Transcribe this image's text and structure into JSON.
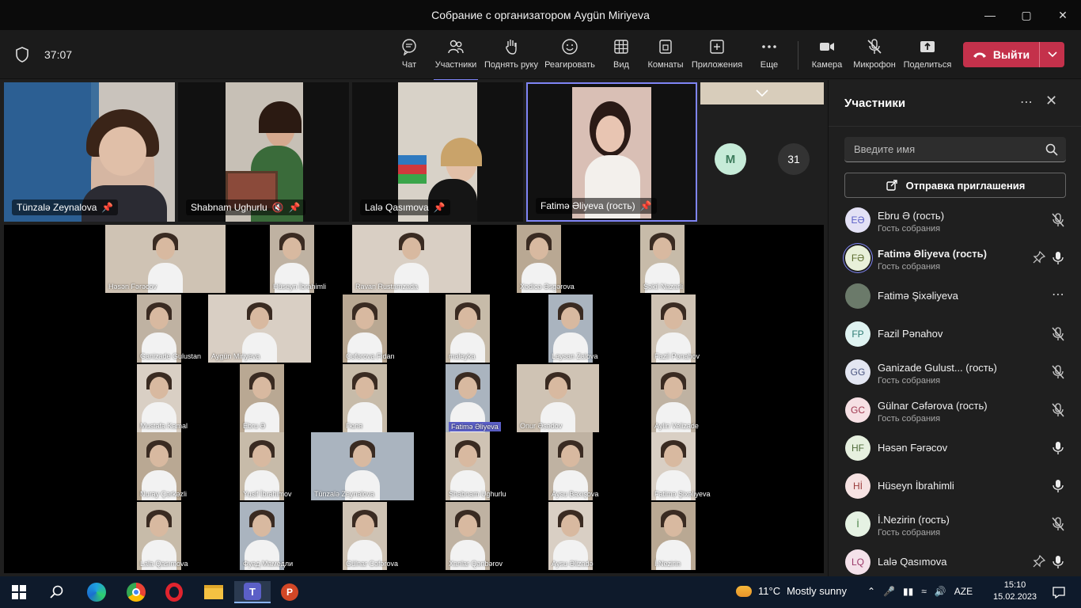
{
  "window": {
    "title": "Собрание с организатором Aygün Miriyeva"
  },
  "toolbar": {
    "timer": "37:07",
    "buttons": [
      {
        "label": "Чат"
      },
      {
        "label": "Участники"
      },
      {
        "label": "Поднять руку"
      },
      {
        "label": "Реагировать"
      },
      {
        "label": "Вид"
      },
      {
        "label": "Комнаты"
      },
      {
        "label": "Приложения"
      },
      {
        "label": "Еще"
      },
      {
        "label": "Камера"
      },
      {
        "label": "Микрофон"
      },
      {
        "label": "Поделиться"
      }
    ],
    "leave_label": "Выйти"
  },
  "stage": {
    "pinned": [
      {
        "name": "Tünzalə Zeynalova"
      },
      {
        "name": "Shabnam Ughurlu"
      },
      {
        "name": "Lalə Qasımova"
      },
      {
        "name": "Fatimə Əliyeva (гость)"
      }
    ],
    "overflow": {
      "avatar_initial": "M",
      "count": "31"
    },
    "grid_labels": [
      "Həsən Fərəcov",
      "Hüseyn İbrahimli",
      "Ravan Rustamzada",
      "Xədicə Əsgərova",
      "Şəkil Nazarli",
      "Ganizade Gulustan",
      "Aygün Miriyeva",
      "Cəfərova Fidan",
      "maleyka",
      "Leysan Zalova",
      "Fazil Pənahov",
      "Mustafa Kamal",
      "Ebru Ə",
      "Гюля",
      "Fatimə Əliyeva",
      "Onur Əsədov",
      "Aylin Velizade",
      "Nuray Çərkəzli",
      "Yusif İbrahimov",
      "Tünzalə Zeynalova",
      "Shabnam Ughurlu",
      "Aysu Baxışova",
      "Fatimə Şixəliyeva",
      "Lala Qasımova",
      "Фуад Мамедли",
      "Gülnar Cəfərova",
      "Xanlar Qənbərov",
      "Aysu Əlizadə",
      "İ.Nezirin"
    ]
  },
  "panel": {
    "title": "Участники",
    "search_placeholder": "Введите имя",
    "invite_label": "Отправка приглашения",
    "participants": [
      {
        "initials": "EƏ",
        "name": "Ebru Ə (гость)",
        "role": "Гость собрания",
        "bg": "#e3e1f5",
        "fg": "#5b5fc7",
        "mic": "off"
      },
      {
        "initials": "FƏ",
        "name": "Fatimə Əliyeva (гость)",
        "role": "Гость собрания",
        "bg": "#e8f0d9",
        "fg": "#5a6b2d",
        "mic": "on",
        "pinned": true,
        "bold": true
      },
      {
        "initials": "",
        "name": "Fatimə Şixəliyeva",
        "role": "",
        "bg": "#6b7a6a",
        "fg": "#fff",
        "mic": "more"
      },
      {
        "initials": "FP",
        "name": "Fazil Pənahov",
        "role": "",
        "bg": "#dff3f1",
        "fg": "#2f7c74",
        "mic": "off"
      },
      {
        "initials": "GG",
        "name": "Ganizade Gulust...  (гость)",
        "role": "Гость собрания",
        "bg": "#e3e6f2",
        "fg": "#4a5580",
        "mic": "off"
      },
      {
        "initials": "GC",
        "name": "Gülnar Cəfərova (гость)",
        "role": "Гость собрания",
        "bg": "#f6e0e4",
        "fg": "#a03a52",
        "mic": "off"
      },
      {
        "initials": "HF",
        "name": "Həsən Fərəcov",
        "role": "",
        "bg": "#e6f0df",
        "fg": "#4f6b3a",
        "mic": "on"
      },
      {
        "initials": "Hİ",
        "name": "Hüseyn İbrahimli",
        "role": "",
        "bg": "#f6e2e2",
        "fg": "#9a3a3a",
        "mic": "on"
      },
      {
        "initials": "İ",
        "name": "İ.Nezirin (гость)",
        "role": "Гость собрания",
        "bg": "#e5f2e3",
        "fg": "#3d7a3a",
        "mic": "off"
      },
      {
        "initials": "LQ",
        "name": "Lalə Qasımova",
        "role": "",
        "bg": "#f4e1ea",
        "fg": "#9c3a6a",
        "mic": "on",
        "pinned": true
      }
    ]
  },
  "taskbar": {
    "weather_temp": "11°C",
    "weather_text": "Mostly sunny",
    "lang": "AZE",
    "time": "15:10",
    "date": "15.02.2023"
  }
}
